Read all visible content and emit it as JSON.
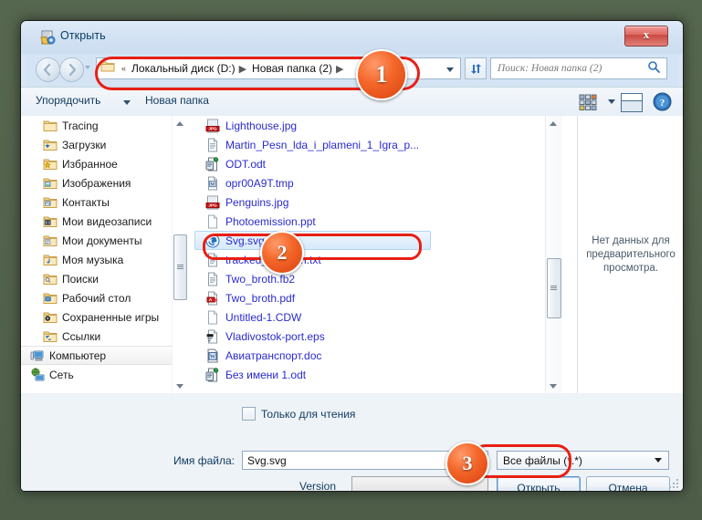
{
  "window": {
    "title": "Открыть",
    "title_icon": "open-file-icon",
    "close_label": "x"
  },
  "nav": {
    "back_icon": "back-arrow-icon",
    "forward_icon": "forward-arrow-icon",
    "history_icon": "chevron-down-icon",
    "address": {
      "folder_icon": "folder-icon",
      "overflow": "«",
      "crumbs": [
        {
          "label": "Локальный диск (D:)"
        },
        {
          "label": "Новая папка (2)"
        }
      ],
      "dropdown_icon": "chevron-down-icon"
    },
    "refresh_icon": "refresh-icon",
    "search": {
      "placeholder": "Поиск: Новая папка (2)",
      "icon": "search-icon"
    }
  },
  "toolbar": {
    "organize_label": "Упорядочить",
    "organize_caret_icon": "chevron-down-icon",
    "new_folder_label": "Новая папка",
    "views_icon": "views-icon",
    "views_caret_icon": "chevron-down-icon",
    "preview_pane_icon": "preview-pane-icon",
    "help_icon": "help-icon"
  },
  "nav_pane": {
    "items": [
      {
        "label": "Tracing",
        "icon": "folder-icon",
        "level": 2,
        "selected": false
      },
      {
        "label": "Загрузки",
        "icon": "downloads-folder-icon",
        "level": 2,
        "selected": false
      },
      {
        "label": "Избранное",
        "icon": "favorites-folder-icon",
        "level": 2,
        "selected": false
      },
      {
        "label": "Изображения",
        "icon": "pictures-folder-icon",
        "level": 2,
        "selected": false
      },
      {
        "label": "Контакты",
        "icon": "contacts-folder-icon",
        "level": 2,
        "selected": false
      },
      {
        "label": "Мои видеозаписи",
        "icon": "videos-folder-icon",
        "level": 2,
        "selected": false
      },
      {
        "label": "Мои документы",
        "icon": "documents-folder-icon",
        "level": 2,
        "selected": false
      },
      {
        "label": "Моя музыка",
        "icon": "music-folder-icon",
        "level": 2,
        "selected": false
      },
      {
        "label": "Поиски",
        "icon": "searches-folder-icon",
        "level": 2,
        "selected": false
      },
      {
        "label": "Рабочий стол",
        "icon": "desktop-folder-icon",
        "level": 2,
        "selected": false
      },
      {
        "label": "Сохраненные игры",
        "icon": "saved-games-folder-icon",
        "level": 2,
        "selected": false
      },
      {
        "label": "Ссылки",
        "icon": "links-folder-icon",
        "level": 2,
        "selected": false
      },
      {
        "label": "Компьютер",
        "icon": "computer-icon",
        "level": 1,
        "selected": true
      },
      {
        "label": "Сеть",
        "icon": "network-icon",
        "level": 1,
        "selected": false
      }
    ],
    "scroll_up_icon": "scroll-up-arrow",
    "scroll_down_icon": "scroll-down-arrow"
  },
  "file_list": {
    "items": [
      {
        "name": "Lighthouse.jpg",
        "icon": "jpg-file-icon",
        "selected": false
      },
      {
        "name": "Martin_Pesn_lda_i_plameni_1_Igra_p...",
        "icon": "text-file-icon",
        "selected": false
      },
      {
        "name": "ODT.odt",
        "icon": "odt-file-icon",
        "selected": false
      },
      {
        "name": "opr00A9T.tmp",
        "icon": "doc-file-icon",
        "selected": false
      },
      {
        "name": "Penguins.jpg",
        "icon": "jpg-file-icon",
        "selected": false
      },
      {
        "name": "Photoemission.ppt",
        "icon": "blank-file-icon",
        "selected": false
      },
      {
        "name": "Svg.svg",
        "icon": "svg-file-icon",
        "selected": true
      },
      {
        "name": "tracked_by_h...n.txt",
        "icon": "text-file-icon",
        "selected": false
      },
      {
        "name": "Two_broth.fb2",
        "icon": "text-file-icon",
        "selected": false
      },
      {
        "name": "Two_broth.pdf",
        "icon": "pdf-file-icon",
        "selected": false
      },
      {
        "name": "Untitled-1.CDW",
        "icon": "blank-file-icon",
        "selected": false
      },
      {
        "name": "Vladivostok-port.eps",
        "icon": "eps-file-icon",
        "selected": false
      },
      {
        "name": "Авиатранспорт.doc",
        "icon": "word-file-icon",
        "selected": false
      },
      {
        "name": "Без имени 1.odt",
        "icon": "odt-file-icon",
        "selected": false
      }
    ],
    "scroll_up_icon": "scroll-up-arrow",
    "scroll_down_icon": "scroll-down-arrow"
  },
  "preview_pane": {
    "message": "Нет данных для предварительного просмотра."
  },
  "bottom": {
    "readonly_label": "Только для чтения",
    "readonly_checked": false,
    "file_name_label": "Имя файла:",
    "file_name_value": "Svg.svg",
    "file_name_caret_icon": "chevron-down-icon",
    "filter_value": "Все файлы (*.*)",
    "filter_caret_icon": "chevron-down-icon",
    "version_label": "Version",
    "version_value": "",
    "open_button": "Открыть",
    "open_button_accel": "О",
    "open_button_rest": "ткрыть",
    "cancel_button": "Отмена"
  },
  "annotations": {
    "callouts": [
      {
        "number": "1",
        "target": "address-bar"
      },
      {
        "number": "2",
        "target": "file-row-svg"
      },
      {
        "number": "3",
        "target": "open-button"
      }
    ],
    "highlight_color": "#e81f13"
  }
}
